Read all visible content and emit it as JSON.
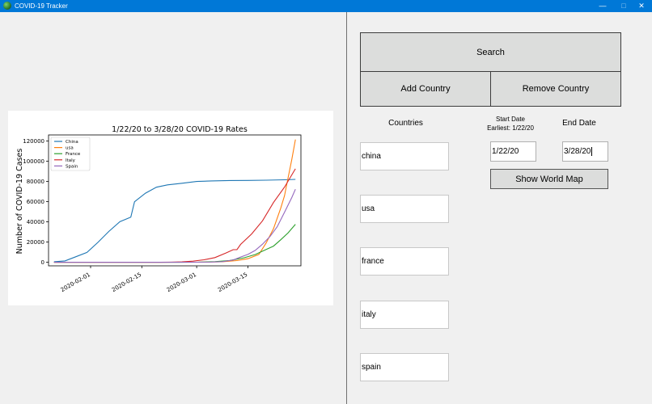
{
  "window": {
    "title": "COVID-19 Tracker",
    "controls": {
      "minimize": "—",
      "maximize": "□",
      "close": "✕"
    }
  },
  "controls": {
    "search_label": "Search",
    "add_country_label": "Add Country",
    "remove_country_label": "Remove Country",
    "countries_label": "Countries",
    "start_date_label": "Start Date",
    "earliest_label": "Earliest: 1/22/20",
    "end_date_label": "End Date",
    "start_date_value": "1/22/20",
    "end_date_value": "3/28/20",
    "show_map_label": "Show World Map",
    "countries": [
      "china",
      "usa",
      "france",
      "italy",
      "spain"
    ]
  },
  "chart_data": {
    "type": "line",
    "title": "1/22/20 to 3/28/20 COVID-19 Rates",
    "xlabel": "",
    "ylabel": "Number of COVID-19 Cases",
    "x_start": "2020-01-22",
    "x_ticks": [
      "2020-02-01",
      "2020-02-15",
      "2020-03-01",
      "2020-03-15"
    ],
    "y_ticks": [
      0,
      20000,
      40000,
      60000,
      80000,
      100000,
      120000
    ],
    "ylim": [
      0,
      121000
    ],
    "grid": false,
    "legend_position": "top-left",
    "series": [
      {
        "name": "China",
        "color": "#1f77b4",
        "points": [
          [
            "2020-01-22",
            548
          ],
          [
            "2020-01-25",
            1406
          ],
          [
            "2020-01-28",
            5509
          ],
          [
            "2020-01-31",
            9802
          ],
          [
            "2020-02-03",
            19716
          ],
          [
            "2020-02-06",
            30587
          ],
          [
            "2020-02-09",
            40150
          ],
          [
            "2020-02-12",
            44690
          ],
          [
            "2020-02-13",
            59865
          ],
          [
            "2020-02-16",
            68347
          ],
          [
            "2020-02-19",
            74280
          ],
          [
            "2020-02-22",
            76567
          ],
          [
            "2020-02-26",
            78191
          ],
          [
            "2020-03-01",
            79932
          ],
          [
            "2020-03-05",
            80552
          ],
          [
            "2020-03-10",
            80904
          ],
          [
            "2020-03-15",
            81003
          ],
          [
            "2020-03-20",
            81250
          ],
          [
            "2020-03-25",
            81661
          ],
          [
            "2020-03-28",
            81999
          ]
        ]
      },
      {
        "name": "usa",
        "color": "#ff7f0e",
        "points": [
          [
            "2020-01-22",
            1
          ],
          [
            "2020-02-20",
            15
          ],
          [
            "2020-03-01",
            74
          ],
          [
            "2020-03-08",
            541
          ],
          [
            "2020-03-12",
            1663
          ],
          [
            "2020-03-15",
            3499
          ],
          [
            "2020-03-18",
            7786
          ],
          [
            "2020-03-20",
            19100
          ],
          [
            "2020-03-22",
            33276
          ],
          [
            "2020-03-24",
            53740
          ],
          [
            "2020-03-25",
            65778
          ],
          [
            "2020-03-26",
            83836
          ],
          [
            "2020-03-27",
            101657
          ],
          [
            "2020-03-28",
            121478
          ]
        ]
      },
      {
        "name": "France",
        "color": "#2ca02c",
        "points": [
          [
            "2020-01-22",
            0
          ],
          [
            "2020-02-25",
            14
          ],
          [
            "2020-03-01",
            130
          ],
          [
            "2020-03-06",
            653
          ],
          [
            "2020-03-10",
            1784
          ],
          [
            "2020-03-14",
            4480
          ],
          [
            "2020-03-17",
            7699
          ],
          [
            "2020-03-20",
            12612
          ],
          [
            "2020-03-22",
            16044
          ],
          [
            "2020-03-24",
            22304
          ],
          [
            "2020-03-26",
            29155
          ],
          [
            "2020-03-28",
            37575
          ]
        ]
      },
      {
        "name": "Italy",
        "color": "#d62728",
        "points": [
          [
            "2020-01-22",
            0
          ],
          [
            "2020-02-20",
            3
          ],
          [
            "2020-02-23",
            155
          ],
          [
            "2020-02-26",
            453
          ],
          [
            "2020-02-29",
            1128
          ],
          [
            "2020-03-03",
            2502
          ],
          [
            "2020-03-06",
            4636
          ],
          [
            "2020-03-09",
            9172
          ],
          [
            "2020-03-11",
            12462
          ],
          [
            "2020-03-12",
            12462
          ],
          [
            "2020-03-13",
            17660
          ],
          [
            "2020-03-16",
            27980
          ],
          [
            "2020-03-19",
            41035
          ],
          [
            "2020-03-22",
            59138
          ],
          [
            "2020-03-25",
            74386
          ],
          [
            "2020-03-28",
            92472
          ]
        ]
      },
      {
        "name": "Spain",
        "color": "#9467bd",
        "points": [
          [
            "2020-01-22",
            0
          ],
          [
            "2020-02-25",
            6
          ],
          [
            "2020-03-01",
            84
          ],
          [
            "2020-03-05",
            282
          ],
          [
            "2020-03-08",
            673
          ],
          [
            "2020-03-11",
            2277
          ],
          [
            "2020-03-13",
            5232
          ],
          [
            "2020-03-15",
            7798
          ],
          [
            "2020-03-17",
            11748
          ],
          [
            "2020-03-19",
            17963
          ],
          [
            "2020-03-21",
            25374
          ],
          [
            "2020-03-23",
            35136
          ],
          [
            "2020-03-25",
            49515
          ],
          [
            "2020-03-27",
            64059
          ],
          [
            "2020-03-28",
            72248
          ]
        ]
      }
    ]
  }
}
